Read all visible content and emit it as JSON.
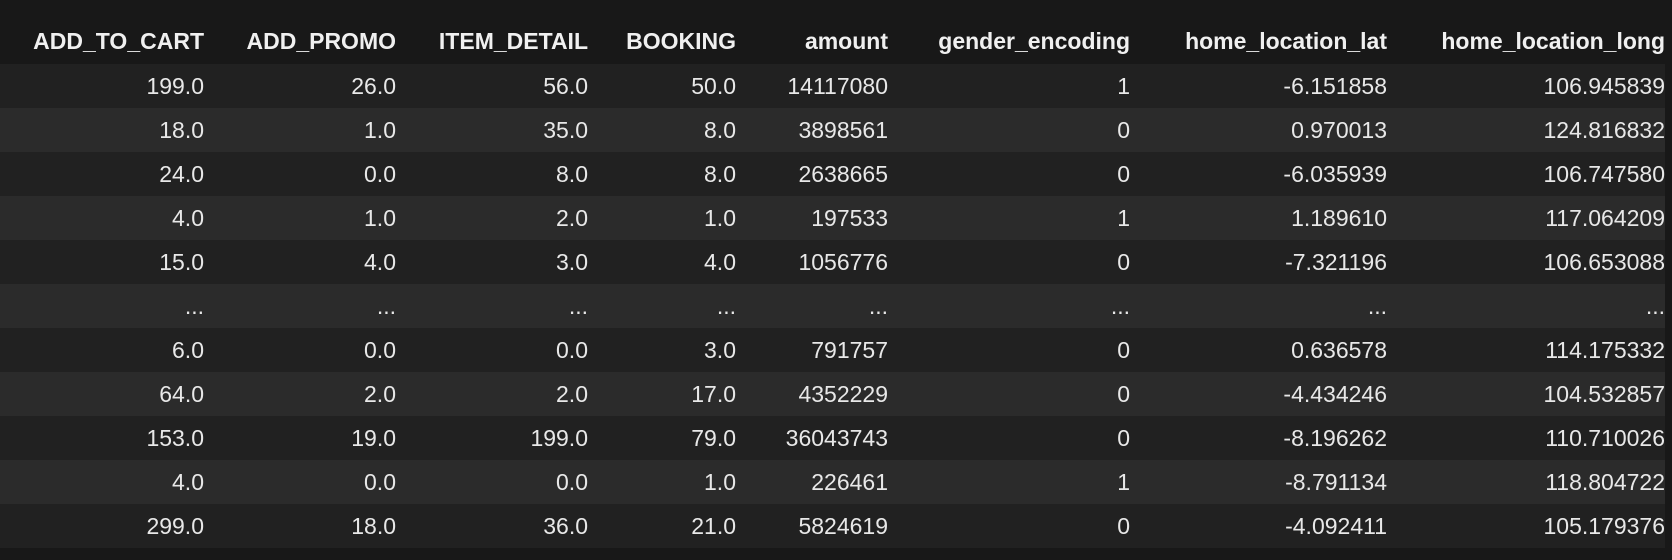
{
  "table": {
    "columns": [
      "ADD_TO_CART",
      "ADD_PROMO",
      "ITEM_DETAIL",
      "BOOKING",
      "amount",
      "gender_encoding",
      "home_location_lat",
      "home_location_long"
    ],
    "rows": [
      [
        "199.0",
        "26.0",
        "56.0",
        "50.0",
        "14117080",
        "1",
        "-6.151858",
        "106.945839"
      ],
      [
        "18.0",
        "1.0",
        "35.0",
        "8.0",
        "3898561",
        "0",
        "0.970013",
        "124.816832"
      ],
      [
        "24.0",
        "0.0",
        "8.0",
        "8.0",
        "2638665",
        "0",
        "-6.035939",
        "106.747580"
      ],
      [
        "4.0",
        "1.0",
        "2.0",
        "1.0",
        "197533",
        "1",
        "1.189610",
        "117.064209"
      ],
      [
        "15.0",
        "4.0",
        "3.0",
        "4.0",
        "1056776",
        "0",
        "-7.321196",
        "106.653088"
      ],
      [
        "...",
        "...",
        "...",
        "...",
        "...",
        "...",
        "...",
        "..."
      ],
      [
        "6.0",
        "0.0",
        "0.0",
        "3.0",
        "791757",
        "0",
        "0.636578",
        "114.175332"
      ],
      [
        "64.0",
        "2.0",
        "2.0",
        "17.0",
        "4352229",
        "0",
        "-4.434246",
        "104.532857"
      ],
      [
        "153.0",
        "19.0",
        "199.0",
        "79.0",
        "36043743",
        "0",
        "-8.196262",
        "110.710026"
      ],
      [
        "4.0",
        "0.0",
        "0.0",
        "1.0",
        "226461",
        "1",
        "-8.791134",
        "118.804722"
      ],
      [
        "299.0",
        "18.0",
        "36.0",
        "21.0",
        "5824619",
        "0",
        "-4.092411",
        "105.179376"
      ]
    ]
  }
}
